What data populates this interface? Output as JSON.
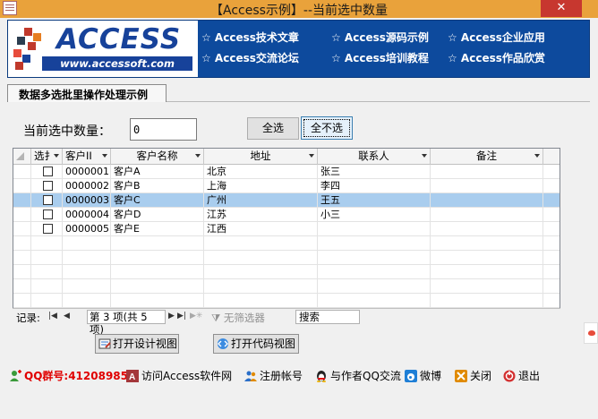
{
  "window": {
    "title": "【Access示例】--当前选中数量"
  },
  "banner": {
    "logo_text": "ACCESS",
    "logo_url": "www.accessoft.com",
    "links": [
      "☆ Access技术文章",
      "☆ Access源码示例",
      "☆ Access企业应用",
      "☆ Access交流论坛",
      "☆ Access培训教程",
      "☆ Access作品欣赏"
    ]
  },
  "tab": {
    "label": "数据多选批里操作处理示例"
  },
  "count": {
    "label": "当前选中数量：",
    "value": "0"
  },
  "buttons": {
    "select_all": "全选",
    "deselect_all": "全不选"
  },
  "grid": {
    "columns": [
      "选扌",
      "客户II",
      "客户名称",
      "地址",
      "联系人",
      "备注"
    ],
    "rows": [
      {
        "id": "0000001",
        "name": "客户A",
        "address": "北京",
        "contact": "张三",
        "note": ""
      },
      {
        "id": "0000002",
        "name": "客户B",
        "address": "上海",
        "contact": "李四",
        "note": ""
      },
      {
        "id": "0000003",
        "name": "客户C",
        "address": "广州",
        "contact": "王五",
        "note": "",
        "selected": true
      },
      {
        "id": "0000004",
        "name": "客户D",
        "address": "江苏",
        "contact": "小三",
        "note": ""
      },
      {
        "id": "0000005",
        "name": "客户E",
        "address": "江西",
        "contact": "",
        "note": ""
      }
    ]
  },
  "navigator": {
    "label": "记录:",
    "current": "第 3 项(共 5 项)",
    "filter": "无筛选器",
    "search": "搜索"
  },
  "actions": {
    "design_view": "打开设计视图",
    "code_view": "打开代码视图"
  },
  "footer": {
    "qq": "QQ群号:41208985",
    "visit": "访问Access软件网",
    "register": "注册帐号",
    "chat": "与作者QQ交流",
    "weibo": "微博",
    "close": "关闭",
    "exit": "退出"
  },
  "colors": {
    "banner_bg": "#0d4a9d",
    "titlebar": "#e9a23b",
    "selected_row": "#a9cdee",
    "qq_text": "#e00000"
  }
}
